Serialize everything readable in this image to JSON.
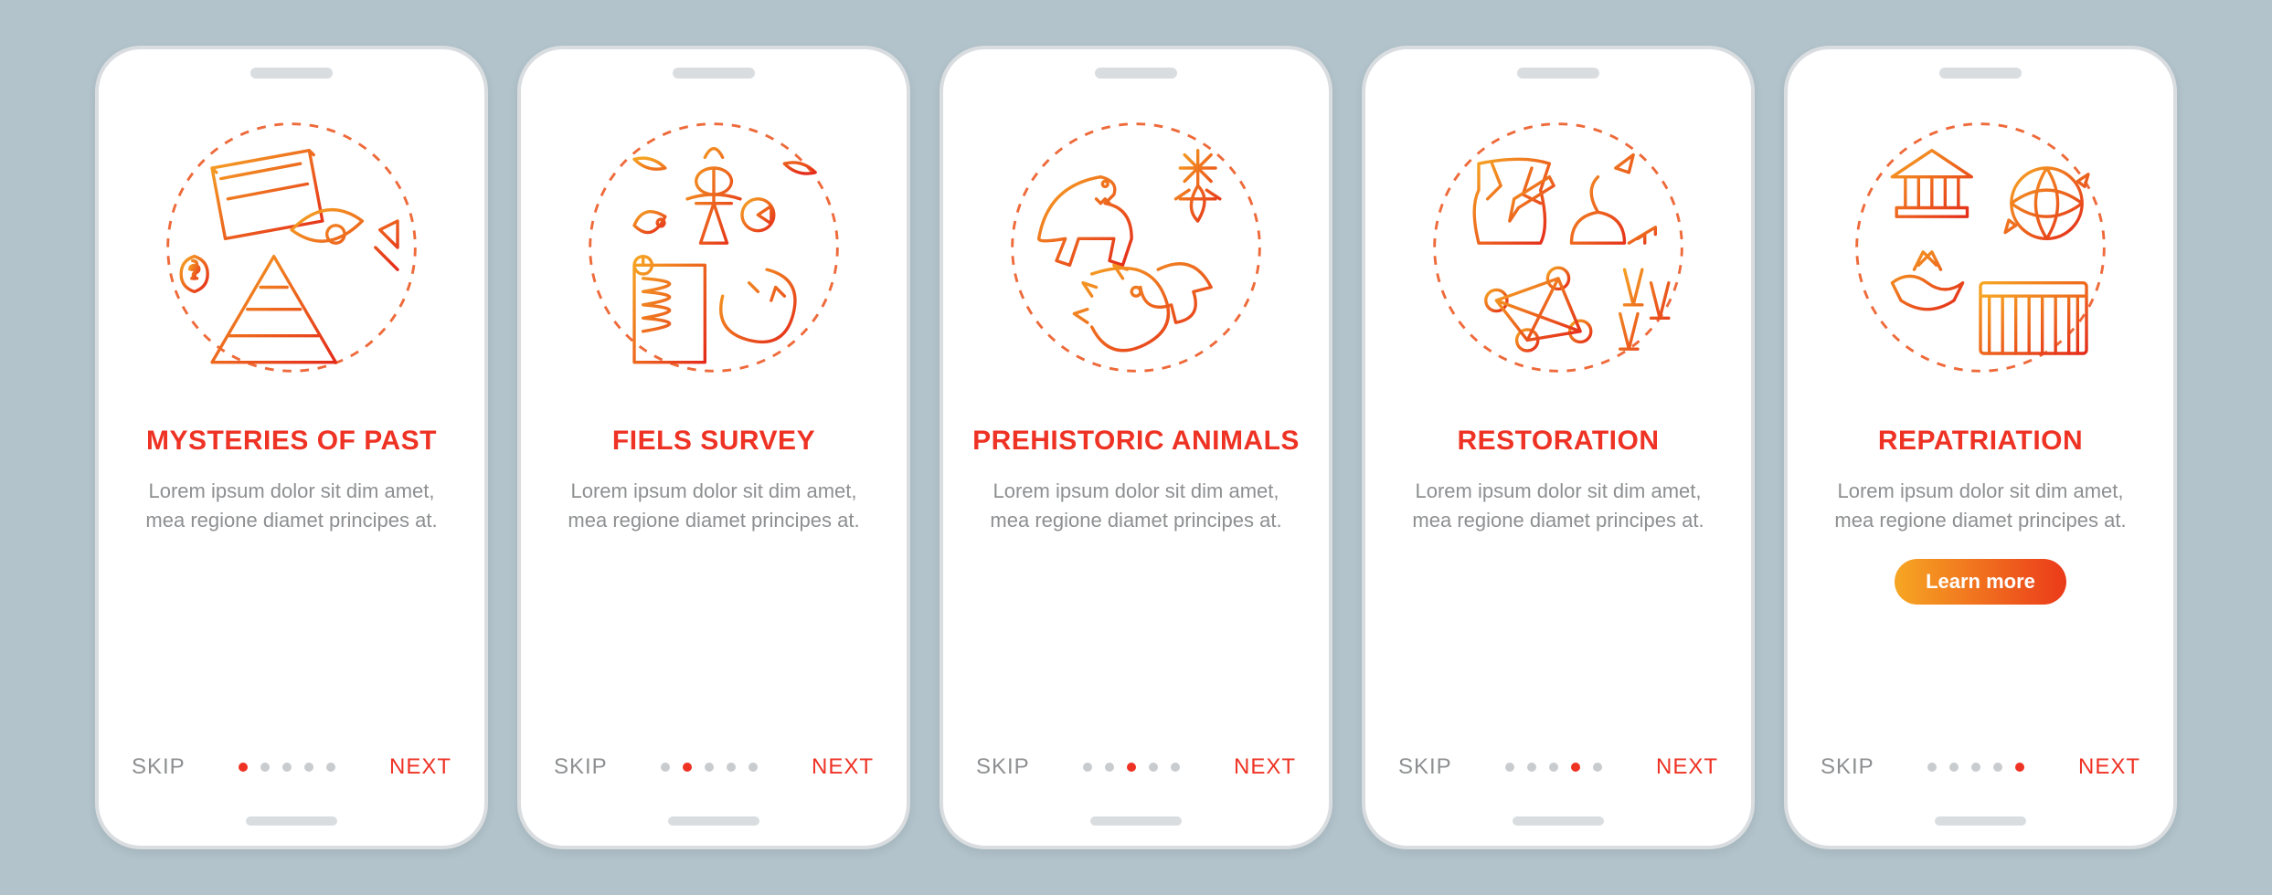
{
  "common": {
    "skip": "SKIP",
    "next": "NEXT",
    "description": "Lorem ipsum dolor sit dim amet, mea regione diamet principes at.",
    "cta": "Learn more",
    "total_pages": 5,
    "accent_color": "#ee3224",
    "muted_color": "#8d8f91"
  },
  "pages": [
    {
      "title": "Mysteries of past",
      "active_dot": 0,
      "icon_name": "mysteries-icon",
      "has_cta": false
    },
    {
      "title": "Fiels survey",
      "active_dot": 1,
      "icon_name": "survey-icon",
      "has_cta": false
    },
    {
      "title": "Prehistoric animals",
      "active_dot": 2,
      "icon_name": "prehistoric-icon",
      "has_cta": false
    },
    {
      "title": "Restoration",
      "active_dot": 3,
      "icon_name": "restoration-icon",
      "has_cta": false
    },
    {
      "title": "Repatriation",
      "active_dot": 4,
      "icon_name": "repatriation-icon",
      "has_cta": true
    }
  ]
}
